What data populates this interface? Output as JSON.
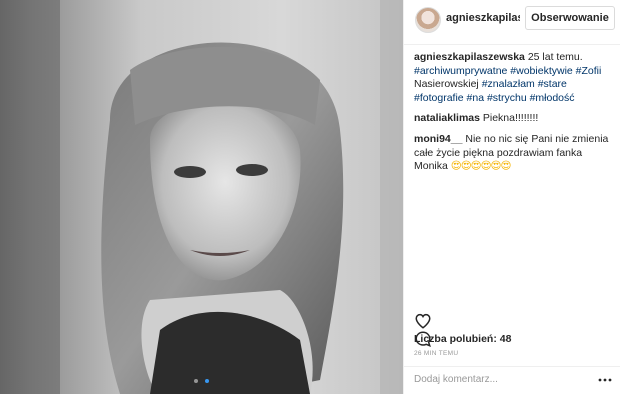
{
  "post": {
    "username_short": "agnieszkapilas",
    "follow_label": "Obserwowanie",
    "photo_count": 2,
    "active_photo": 2
  },
  "caption": {
    "username": "agnieszkapilaszewska",
    "text": " 25 lat temu. ",
    "tags_1": "#archiwumprywatne #wobiektywie #Zofii",
    "text_2": " Nasierowskiej ",
    "tags_2": "#znalazłam #stare #fotografie #na #strychu #młodość"
  },
  "comments": [
    {
      "username": "nataliaklimas",
      "text": " Piekna!!!!!!!!"
    },
    {
      "username": "moni94__",
      "text": " Nie no nic się Pani nie zmienia całe życie piękna pozdrawiam fanka Monika ",
      "emoji": "😍😍😍😍😍😍"
    }
  ],
  "stats": {
    "likes_label": "Liczba polubień: 48",
    "time_label": "26 MIN TEMU"
  },
  "input": {
    "placeholder": "Dodaj komentarz..."
  },
  "icons": {
    "like": "heart-outline-icon",
    "comment": "speech-bubble-icon",
    "more": "more-dots-icon"
  },
  "colors": {
    "link": "#003569",
    "accent": "#3897f0",
    "muted": "#999999"
  }
}
